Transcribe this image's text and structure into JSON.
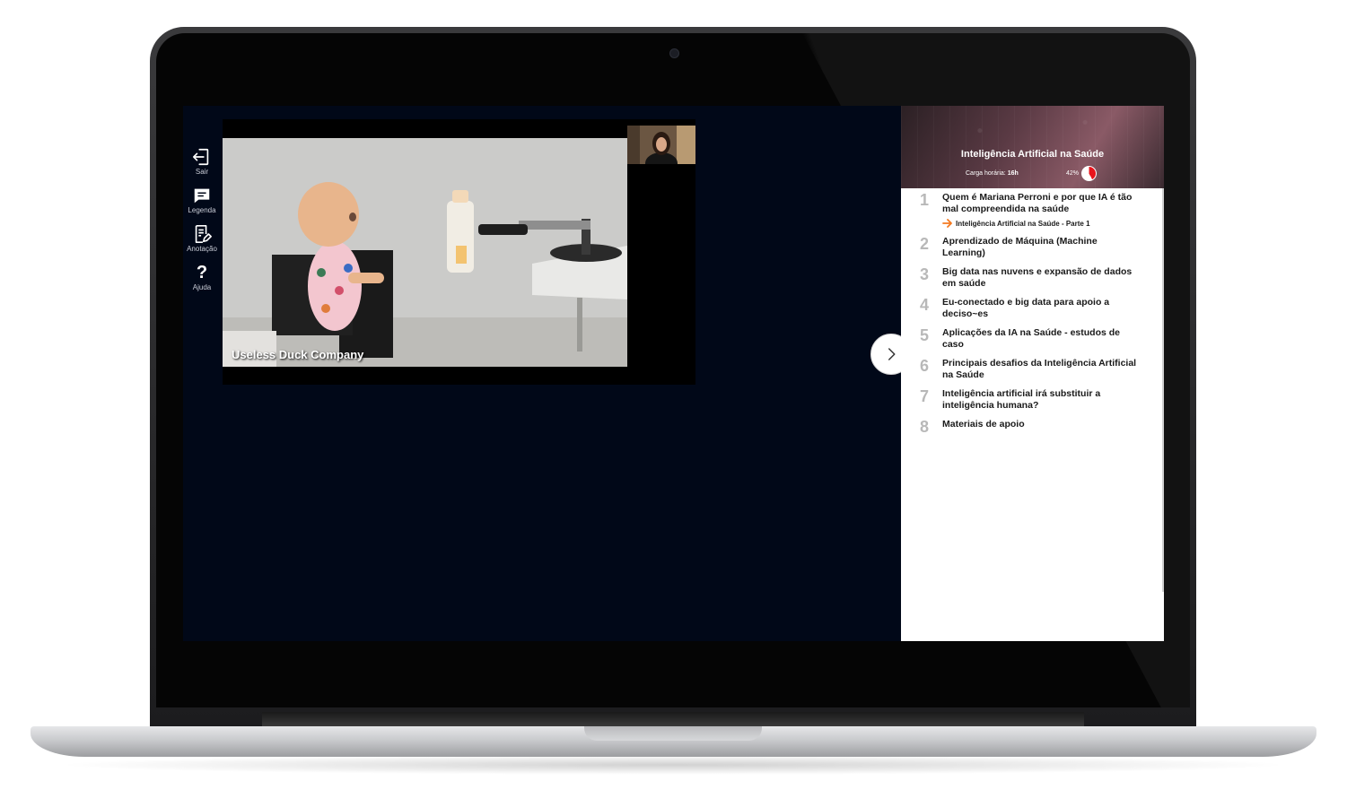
{
  "toolbar": {
    "items": [
      {
        "label": "Sair",
        "icon": "exit-icon"
      },
      {
        "label": "Legenda",
        "icon": "subtitle-icon"
      },
      {
        "label": "Anotação",
        "icon": "note-icon"
      },
      {
        "label": "Ajuda",
        "icon": "help-icon",
        "glyph": "?"
      }
    ]
  },
  "video": {
    "caption": "Useless Duck Company"
  },
  "course": {
    "title": "Inteligência Artificial na Saúde",
    "hours_label": "Carga horária:",
    "hours_value": "16h",
    "progress_label": "42%",
    "progress_value": 0.42,
    "progress_color": "#e8141c",
    "accent_color": "#f47a20",
    "lessons": [
      {
        "num": "1",
        "title": "Quem é Mariana Perroni e por que IA é tão mal compreendida na saúde",
        "sub": "Inteligência Artificial na Saúde - Parte 1"
      },
      {
        "num": "2",
        "title": "Aprendizado de Máquina (Machine Learning)"
      },
      {
        "num": "3",
        "title": "Big data nas nuvens e expansão de dados em saúde"
      },
      {
        "num": "4",
        "title": "Eu-conectado e big data para apoio a deciso~es"
      },
      {
        "num": "5",
        "title": "Aplicações da IA na Saúde - estudos de caso"
      },
      {
        "num": "6",
        "title": "Principais desafios da Inteligência Artificial na Saúde"
      },
      {
        "num": "7",
        "title": "Inteligência artificial irá substituir a inteligência humana?"
      },
      {
        "num": "8",
        "title": "Materiais de apoio"
      }
    ]
  }
}
